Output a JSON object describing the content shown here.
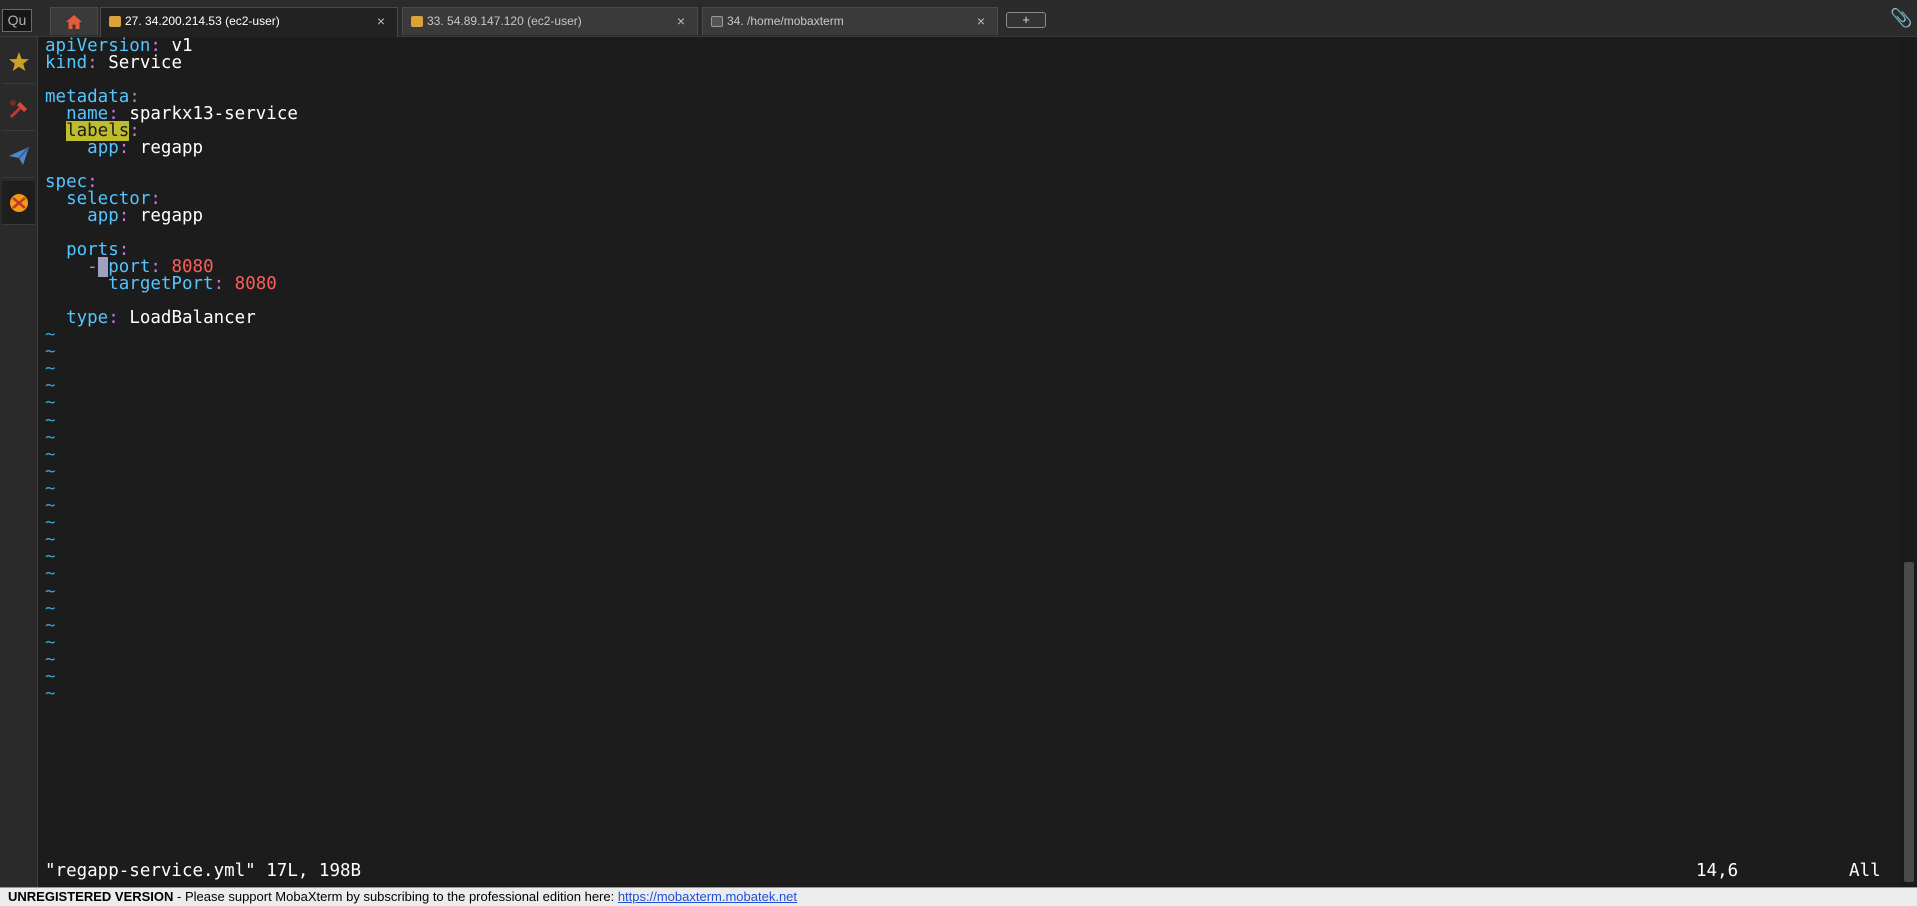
{
  "tabs": [
    {
      "label": "27. 34.200.214.53 (ec2-user)",
      "active": true,
      "icon": "ssh-key-icon"
    },
    {
      "label": "33. 54.89.147.120 (ec2-user)",
      "active": false,
      "icon": "ssh-key-icon"
    },
    {
      "label": "34. /home/mobaxterm",
      "active": false,
      "icon": "terminal-icon"
    }
  ],
  "quick_connect_placeholder": "Qu",
  "close_glyph": "×",
  "new_tab_glyph": "+",
  "sidebar": [
    "star-icon",
    "tools-icon",
    "send-icon",
    "xserver-icon"
  ],
  "editor": {
    "lines": {
      "l1_key": "apiVersion",
      "l1_val": "v1",
      "l2_key": "kind",
      "l2_val": "Service",
      "l4_key": "metadata",
      "l5_key": "name",
      "l5_val": "sparkx13-service",
      "l6_key": "labels",
      "l7_key": "app",
      "l7_val": "regapp",
      "l9_key": "spec",
      "l10_key": "selector",
      "l11_key": "app",
      "l11_val": "regapp",
      "l13_key": "ports",
      "l14_dash": "-",
      "l14_cursor": " ",
      "l14_key": "port",
      "l14_val": "8080",
      "l15_key": "targetPort",
      "l15_val": "8080",
      "l17_key": "type",
      "l17_val": "LoadBalancer"
    },
    "tilde": "~",
    "tilde_count": 22,
    "status_file": "\"regapp-service.yml\" 17L, 198B",
    "status_position": "14,6",
    "status_scroll": "All"
  },
  "banner": {
    "title": "UNREGISTERED VERSION",
    "message": " -  Please support MobaXterm by subscribing to the professional edition here:  ",
    "link": "https://mobaxterm.mobatek.net"
  },
  "colors": {
    "yaml_key": "#54c5ff",
    "yaml_colon": "#c678dd",
    "yaml_number": "#ff5c5c",
    "search_highlight": "#bdbd2e",
    "tilde": "#33a5d8",
    "background": "#1c1c1c"
  }
}
